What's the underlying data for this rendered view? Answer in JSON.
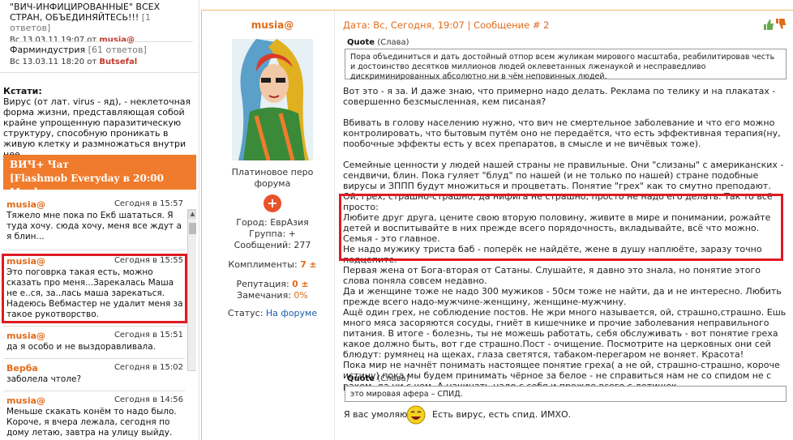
{
  "sidebar": {
    "topics": [
      {
        "title": "\"ВИЧ-ИНФИЦИРОВАННЫЕ\" ВСЕХ СТРАН, ОБЪЕДИНЯЙТЕСЬ!!!",
        "count": "[1 ответов]",
        "date": "Вс 13.03.11 19:07 от",
        "user": "musia@"
      },
      {
        "title": "Фарминдустрия",
        "count": "[61 ответов]",
        "date": "Вс 13.03.11 18:20 от",
        "user": "Butsefal"
      }
    ],
    "kstati_title": "Кстати:",
    "kstati_text": "Вирус (от лат. virus - яд), - неклеточная форма жизни, представляющая собой крайне упрощенную паразитическую структуру, способную проникать в живую клетку и размножаться внутри нее.",
    "chat_title_1": "ВИЧ+ Чат",
    "chat_title_2": "[Flashmob Everyday в 20:00 Мск]",
    "chat": [
      {
        "user": "musia@",
        "time": "Сегодня в 15:57",
        "text": "Тяжело мне пока по Екб шататься. Я туда хочу. сюда хочу, меня все ждут а я блин..."
      },
      {
        "user": "musia@",
        "time": "Сегодня в 15:55",
        "text": "Это поговрка такая есть, можно сказать про меня...Зарекалась Маша не е..ся, за..лась маша зарекаться. Надеюсь Вебмастер не удалит меня за такое рукотворство."
      },
      {
        "user": "musia@",
        "time": "Сегодня в 15:51",
        "text": "да я особо и не выздоравливала."
      },
      {
        "user": "Верба",
        "time": "Сегодня в 15:02",
        "text": "заболела чтоле?"
      },
      {
        "user": "musia@",
        "time": "Сегодня в 14:56",
        "text": "Меньше скакать конём то надо было. Короче, я вчера лежала, сегодня по дому летаю, завтра на улицу выйду."
      }
    ]
  },
  "author": {
    "name": "musia@",
    "rank": "Платиновое перо форума",
    "badge": "+",
    "city_label": "Город:",
    "city": "ЕврАзия",
    "group_label": "Группа:",
    "group": "+",
    "posts_label": "Сообщений:",
    "posts": "277",
    "compliments_label": "Комплименты:",
    "compliments": "7",
    "reputation_label": "Репутация:",
    "reputation": "0",
    "warnings_label": "Замечания:",
    "warnings": "0%",
    "status_label": "Статус:",
    "status": "На форуме"
  },
  "post": {
    "header": "Дата: Вс, Сегодня, 19:07 | Сообщение # 2",
    "quote1_label": "Quote",
    "quote1_author": "(Слава)",
    "quote1_text": "Пора объединиться и дать достойный отпор всем жуликам мирового масштаба, реабилитировав честь и достоинство десятков миллионов людей оклеветанных лженаукой и несправедливо дискриминированных абсолютно ни в чём неповинных людей.",
    "p1": "Вот это - я за. И даже знаю, что примерно надо делать. Реклама по телику и на плакатах - совершенно безсмысленная, кем писаная?",
    "p2": "Вбивать в голову населению нужно, что вич не смертельное заболевание и что его можно контролировать, что бытовым путём оно не передаётся, что есть эффективная терапия(ну, пообочные эффекты есть у всех препаратов, в смысле и не вичёвых тоже).",
    "p3": "Семейные ценности у людей нашей страны не правильные. Они \"слизаны\" с американских - сендвичи, блин. Пока гуляет \"блуд\" по нашей (и не только по нашей) стране подобные вирусы и ЗППП будут множиться и процветать. Понятие \"грех\" как то смутно преподают. Ой, грех, страшно-страшно, да нифига не страшно, просто не надо его делать. Так то всё просто:",
    "p4": "Любите друг друга, цените свою вторую половину, живите в мире и понимании, рожайте детей и воспитывайте в них прежде всего порядочность, вкладывайте, всё что можно.",
    "p5": "Семья - это главное.",
    "p6": "Не надо мужику триста баб - поперёк не найдёте, жене в душу наплюёте, заразу точно подцепите.",
    "p7": "Первая жена от Бога-вторая от Сатаны. Слушайте, я давно это знала, но понятие этого слова поняла совсем недавно.",
    "p8": "Да и женщине тоже не надо 300 мужиков - 50см тоже не найти, да и не интересно. Любить прежде всего надо-мужчине-женщину, женщине-мужчину.",
    "p9": "Ащё один грех, не соблюдение постов. Не жри много называется, ой, страшно,страшно. Ешь много мяса засоряются сосуды, гниёт в кишечнике и прочие заболевания неправильного питания. В итоге - болезнь, ты не можешь работать, себя обслуживать - вот понятие греха какое должно быть, вот где страшно.Пост - очищение. Посмотрите на церковных они сей блюдут: румянец на щеках, глаза светятся, табаком-перегаром не воняет. Красота!",
    "p10": "Пока мир не начнёт понимать настоящее понятие греха( а не ой, страшно-страшно, короче истину) пока мы будем принимать чёрное за белое - не справиться нам не со спидом не с раком, да ни с чем. А начинать надо с себя и прежде всего с детишек.",
    "quote2_label": "Quote",
    "quote2_author": "(Слава)",
    "quote2_text": "это мировая афера – СПИД.",
    "closing_left": "Я вас умоляю",
    "closing_right": "Есть вирус, есть спид. ИМХО."
  }
}
